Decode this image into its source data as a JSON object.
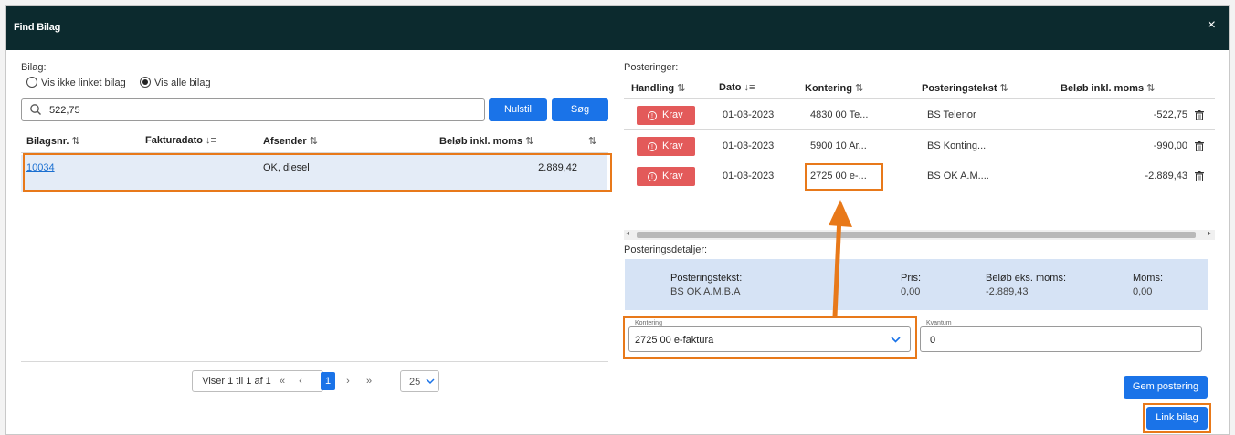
{
  "dialog": {
    "title": "Find Bilag",
    "close_glyph": "×"
  },
  "left": {
    "bilag_label": "Bilag:",
    "radio_1": "Vis ikke linket bilag",
    "radio_2": "Vis alle bilag",
    "radio_selected": "Vis alle bilag",
    "search_value": "522,75",
    "reset_button": "Nulstil",
    "search_button": "Søg",
    "columns": [
      "Bilagsnr.",
      "Fakturadato",
      "Afsender",
      "Beløb inkl. moms",
      ""
    ],
    "rows": [
      {
        "bilagsnr": "10034",
        "fakturadato": "",
        "afsender": "OK, diesel",
        "beloeb": "2.889,42"
      }
    ],
    "pager": {
      "info": "Viser 1 til 1 af 1",
      "first": "«",
      "prev": "‹",
      "current": "1",
      "next": "›",
      "last": "»",
      "page_size": "25"
    }
  },
  "right": {
    "posteringer_label": "Posteringer:",
    "columns": [
      "Handling",
      "Dato",
      "Kontering",
      "Posteringstekst",
      "Beløb inkl. moms"
    ],
    "action_label": "Krav",
    "rows": [
      {
        "dato": "01-03-2023",
        "kontering": "4830 00 Te...",
        "tekst": "BS Telenor",
        "beloeb": "-522,75"
      },
      {
        "dato": "01-03-2023",
        "kontering": "5900 10 Ar...",
        "tekst": "BS Konting...",
        "beloeb": "-990,00"
      },
      {
        "dato": "01-03-2023",
        "kontering": "2725 00 e-...",
        "tekst": "BS OK A.M....",
        "beloeb": "-2.889,43"
      }
    ],
    "details_label": "Posteringsdetaljer:",
    "details": {
      "tekst_label": "Posteringstekst:",
      "tekst_value": "BS OK A.M.B.A",
      "pris_label": "Pris:",
      "pris_value": "0,00",
      "eks_label": "Beløb eks. moms:",
      "eks_value": "-2.889,43",
      "moms_label": "Moms:",
      "moms_value": "0,00"
    },
    "kontering_field": {
      "label": "Kontering",
      "value": "2725 00 e-faktura"
    },
    "kvantum_field": {
      "label": "Kvantum",
      "value": "0"
    },
    "save_button": "Gem postering",
    "link_button": "Link bilag"
  },
  "colors": {
    "header_bg": "#0c2a2e",
    "accent": "#1a73e8",
    "krav": "#e35a5a",
    "highlight": "#e8791a",
    "selected_row": "#e4ecf7"
  }
}
